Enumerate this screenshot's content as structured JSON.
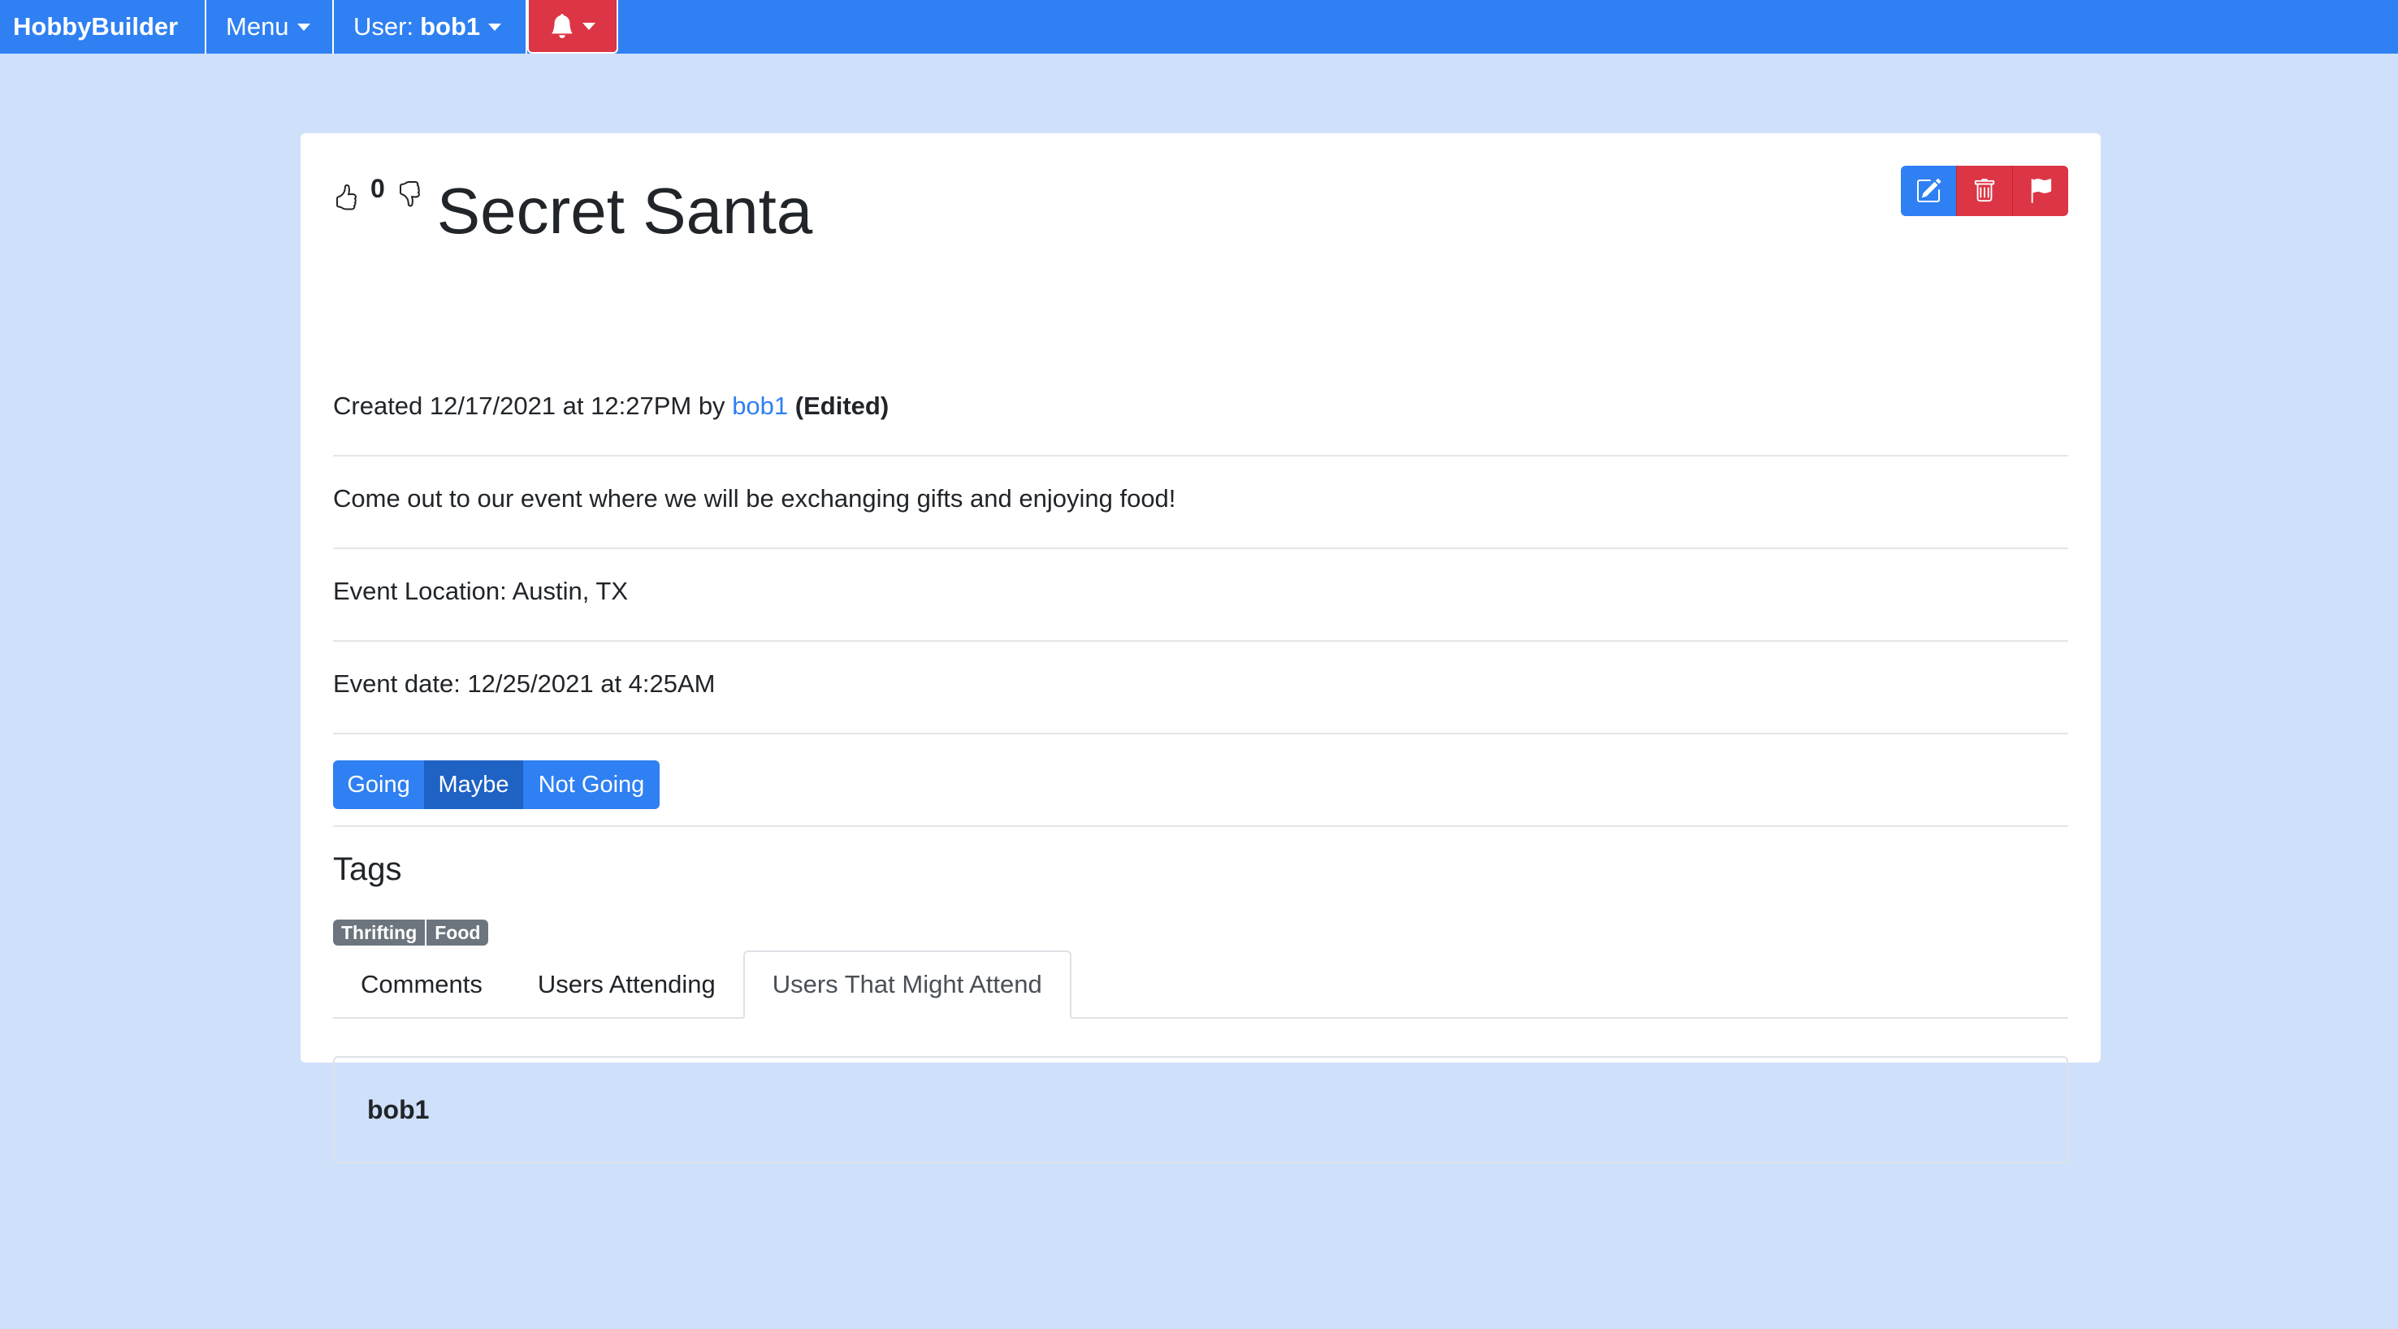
{
  "navbar": {
    "brand": "HobbyBuilder",
    "menu_label": "Menu",
    "user_prefix": "User:",
    "username": "bob1"
  },
  "colors": {
    "primary": "#2f80f2",
    "primary_dark": "#1e62c4",
    "danger": "#dc3545",
    "secondary": "#6c757d",
    "background": "#cfe0fa"
  },
  "event": {
    "vote_count": "0",
    "title": "Secret Santa",
    "created_prefix": "Created 12/17/2021 at 12:27PM by",
    "author": "bob1",
    "edited": "(Edited)",
    "description": "Come out to our event where we will be exchanging gifts and enjoying food!",
    "location": "Event Location: Austin, TX",
    "date": "Event date: 12/25/2021 at 4:25AM"
  },
  "actions": {
    "edit_icon": "edit-icon",
    "delete_icon": "trash-icon",
    "flag_icon": "flag-icon"
  },
  "rsvp": {
    "going": "Going",
    "maybe": "Maybe",
    "not_going": "Not Going",
    "selected": "Maybe"
  },
  "tags": {
    "heading": "Tags",
    "items": [
      "Thrifting",
      "Food"
    ]
  },
  "tabs": {
    "items": [
      "Comments",
      "Users Attending",
      "Users That Might Attend"
    ],
    "active": "Users That Might Attend"
  },
  "panel": {
    "users": [
      "bob1"
    ]
  }
}
